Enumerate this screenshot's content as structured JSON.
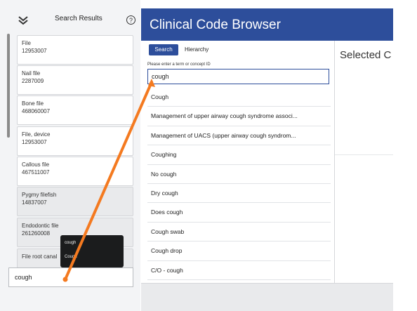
{
  "left_panel": {
    "header": {
      "title": "Search Results",
      "collapse_icon": "chevrons-down-icon",
      "help_icon": "help-circle-icon",
      "help_glyph": "?"
    },
    "results": [
      {
        "name": "File",
        "id": "12953007"
      },
      {
        "name": "Nail file",
        "id": "2287009"
      },
      {
        "name": "Bone file",
        "id": "468060007"
      },
      {
        "name": "File, device",
        "id": "12953007"
      },
      {
        "name": "Callous file",
        "id": "467511007"
      },
      {
        "name": "Pygmy filefish",
        "id": "14837007"
      },
      {
        "name": "Endodontic file",
        "id": "261260008"
      },
      {
        "name": "File root canal"
      }
    ],
    "tooltip": {
      "line1": "cough",
      "line2": "Cough"
    },
    "input": {
      "value": "cough"
    }
  },
  "app": {
    "title": "Clinical Code Browser",
    "tabs": {
      "search": "Search",
      "hierarchy": "Hierarchy"
    },
    "search": {
      "prompt": "Please enter a term or concept ID",
      "value": "cough",
      "results": [
        "Cough",
        "Management of upper airway cough syndrome associ...",
        "Management of UACS (upper airway cough syndrom...",
        "Coughing",
        "No cough",
        "Dry cough",
        "Does cough",
        "Cough swab",
        "Cough drop",
        "C/O - cough"
      ]
    },
    "detail": {
      "title": "Selected C"
    }
  },
  "colors": {
    "brand_blue": "#2d4e9b",
    "annotation_arrow": "#f47a20"
  }
}
